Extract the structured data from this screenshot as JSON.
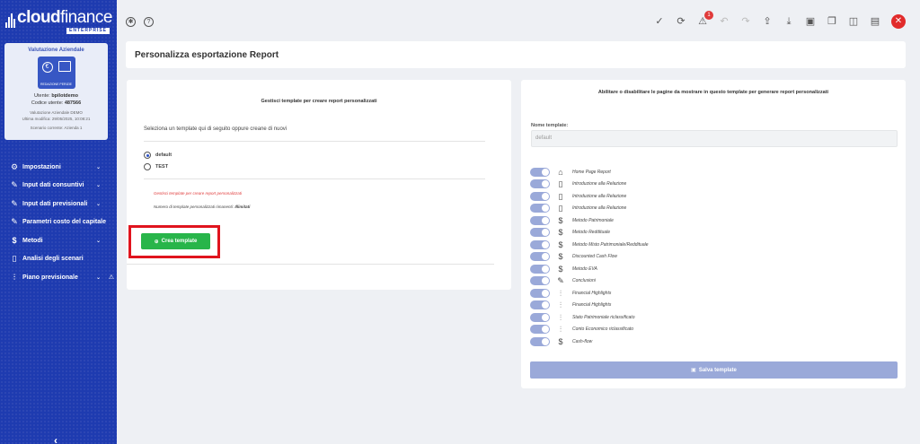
{
  "brand": {
    "name_bold": "cloud",
    "name_light": "finance",
    "tagline": "ENTERPRISE"
  },
  "card": {
    "title": "Valutazione Aziendale",
    "image_caption": "REDAZIONE PERIZIE",
    "user_label": "Utente:",
    "user": "bpilotdemo",
    "code_label": "Codice utente:",
    "code": "487566",
    "company": "Valutazione Aziendale DEMO",
    "last_edit": "Ultima modifica: 29/05/2025, 10:08:21",
    "scenario": "Scenario corrente: Azienda 1"
  },
  "nav": [
    {
      "label": "Impostazioni",
      "icon": "gear-icon",
      "glyph": "⚙",
      "chevron": true
    },
    {
      "label": "Input dati consuntivi",
      "icon": "edit-icon",
      "glyph": "✎",
      "chevron": true
    },
    {
      "label": "Input dati previsionali",
      "icon": "edit-icon",
      "glyph": "✎",
      "chevron": true
    },
    {
      "label": "Parametri costo del capitale",
      "icon": "edit-icon",
      "glyph": "✎",
      "chevron": false
    },
    {
      "label": "Metodi",
      "icon": "dollar-icon",
      "glyph": "$",
      "chevron": true
    },
    {
      "label": "Analisi degli scenari",
      "icon": "book-icon",
      "glyph": "▯",
      "chevron": false
    },
    {
      "label": "Piano previsionale",
      "icon": "chart-icon",
      "glyph": "⫶",
      "chevron": true,
      "warning": true
    }
  ],
  "topbar": {
    "notification_count": "1"
  },
  "page": {
    "title": "Personalizza esportazione Report"
  },
  "left": {
    "title": "Gestisci template per creare report personalizzati",
    "subtitle": "Seleziona un template qui di seguito oppure creane di nuovi",
    "templates": [
      {
        "label": "default",
        "selected": true
      },
      {
        "label": "TEST",
        "selected": false
      }
    ],
    "warning": "Gestisci template per creare report personalizzati",
    "count_text": "Numero di template personalizzati rimanenti:",
    "count_value": "Illimitati",
    "create_label": "Crea template"
  },
  "right": {
    "title": "Abilitare o disabilitare le pagine da mostrare in questo template per generare report personalizzati",
    "name_label": "Nome template:",
    "name_value": "default",
    "pages": [
      {
        "label": "Home Page Report",
        "icon": "home-icon",
        "glyph": "⌂"
      },
      {
        "label": "Introduzione alla Relazione",
        "icon": "book-icon",
        "glyph": "▯"
      },
      {
        "label": "Introduzione alla Relazione",
        "icon": "book-icon",
        "glyph": "▯"
      },
      {
        "label": "Introduzione alla Relazione",
        "icon": "book-icon",
        "glyph": "▯"
      },
      {
        "label": "Metodo Patrimoniale",
        "icon": "dollar-icon",
        "glyph": "$"
      },
      {
        "label": "Metodo Reddituale",
        "icon": "dollar-icon",
        "glyph": "$"
      },
      {
        "label": "Metodo Misto Patrimoniale/Reddituale",
        "icon": "dollar-icon",
        "glyph": "$"
      },
      {
        "label": "Discounted Cash Flow",
        "icon": "dollar-icon",
        "glyph": "$"
      },
      {
        "label": "Metodo EVA",
        "icon": "dollar-icon",
        "glyph": "$"
      },
      {
        "label": "Conclusioni",
        "icon": "pen-icon",
        "glyph": "✎"
      },
      {
        "label": "Financial Highlights",
        "icon": "bar-chart-icon",
        "glyph": "⫶"
      },
      {
        "label": "Financial Highlights",
        "icon": "bar-chart-icon",
        "glyph": "⫶"
      },
      {
        "label": "Stato Patrimoniale riclassificato",
        "icon": "bar-chart-icon",
        "glyph": "⫶"
      },
      {
        "label": "Conto Economico riclassificato",
        "icon": "bar-chart-icon",
        "glyph": "⫶"
      },
      {
        "label": "Cash-flow",
        "icon": "dollar-icon",
        "glyph": "$"
      }
    ],
    "save_label": "Salva template"
  },
  "colors": {
    "sidebar": "#1e3bb0",
    "primary_btn": "#28b54a",
    "disabled_btn": "#9aa9d9",
    "danger": "#e12b2b"
  }
}
